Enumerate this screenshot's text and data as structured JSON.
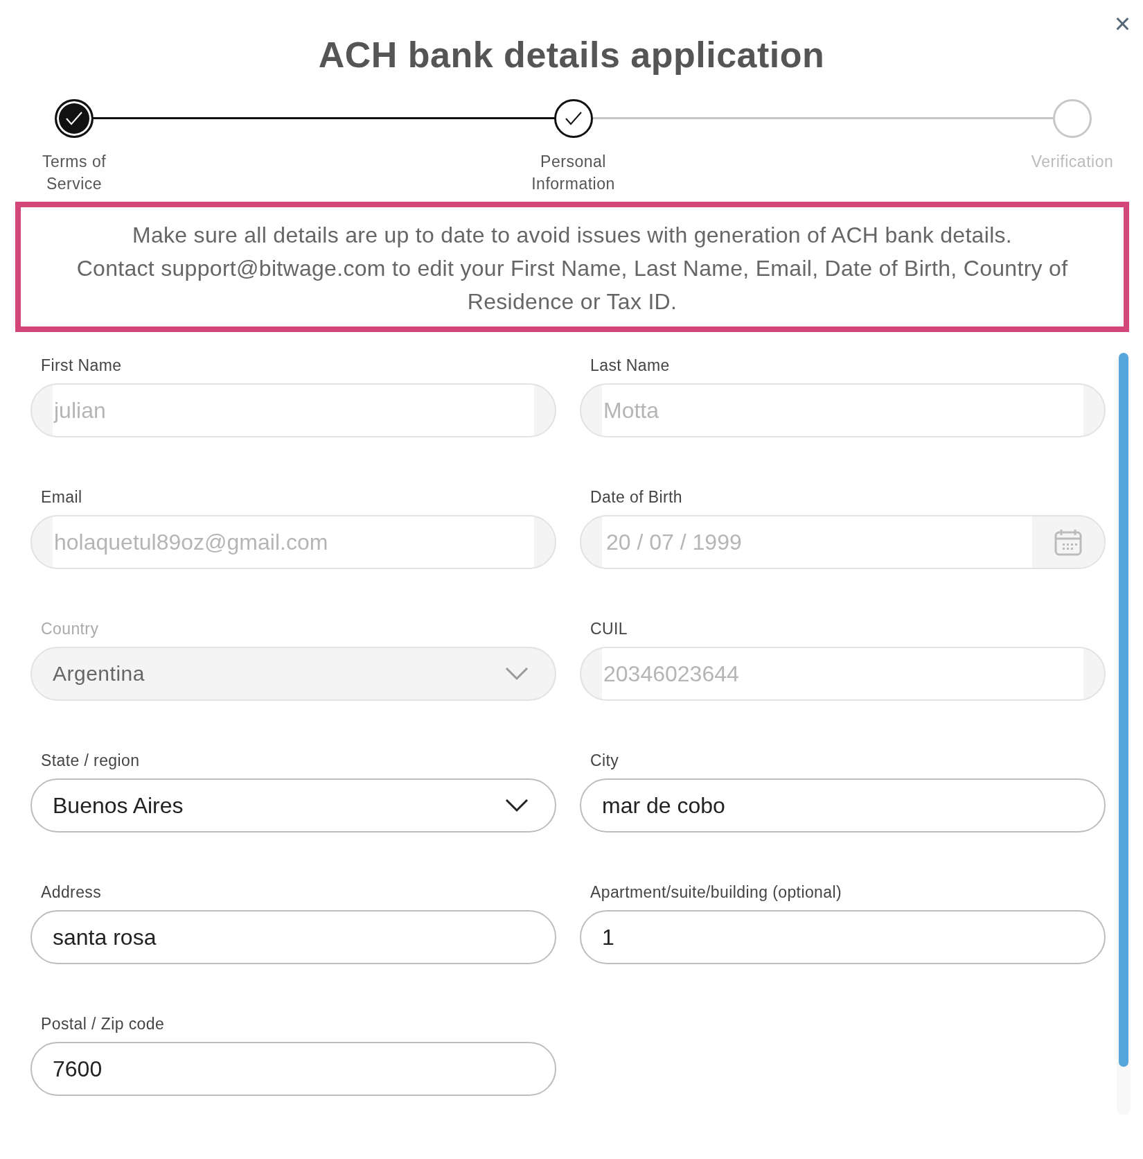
{
  "dialog": {
    "title": "ACH bank details application",
    "close": "×"
  },
  "steps": [
    {
      "label": "Terms of Service",
      "completed": true,
      "current": false
    },
    {
      "label": "Personal Information",
      "completed": false,
      "current": true
    },
    {
      "label": "Verification",
      "completed": false,
      "current": false
    }
  ],
  "notice": [
    "Make sure all details are up to date to avoid issues with generation of ACH bank details.",
    "Contact support@bitwage.com to edit your First Name, Last Name, Email, Date of Birth, Country of Residence or Tax ID."
  ],
  "fields": [
    {
      "label": "First Name",
      "value": "julian",
      "kind": "text",
      "read_only": true,
      "disabled": false
    },
    {
      "label": "Last Name",
      "value": "Motta",
      "kind": "text",
      "read_only": true,
      "disabled": false
    },
    {
      "label": "Email",
      "value": "holaquetul89oz@gmail.com",
      "kind": "text",
      "read_only": true,
      "disabled": false
    },
    {
      "label": "Date of Birth",
      "value": "20 / 07 / 1999",
      "kind": "date",
      "read_only": true,
      "disabled": false
    },
    {
      "label": "Country",
      "value": "Argentina",
      "kind": "select",
      "read_only": false,
      "disabled": true
    },
    {
      "label": "CUIL",
      "value": "20346023644",
      "kind": "text",
      "read_only": true,
      "disabled": false
    },
    {
      "label": "State / region",
      "value": "Buenos Aires",
      "kind": "select",
      "read_only": false,
      "disabled": false
    },
    {
      "label": "City",
      "value": "mar de cobo",
      "kind": "text",
      "read_only": false,
      "disabled": false
    },
    {
      "label": "Address",
      "value": "santa rosa",
      "kind": "text",
      "read_only": false,
      "disabled": false
    },
    {
      "label": "Apartment/suite/building (optional)",
      "value": "1",
      "kind": "text",
      "read_only": false,
      "disabled": false
    },
    {
      "label": "Postal / Zip code",
      "value": "7600",
      "kind": "text",
      "read_only": false,
      "disabled": false
    }
  ]
}
